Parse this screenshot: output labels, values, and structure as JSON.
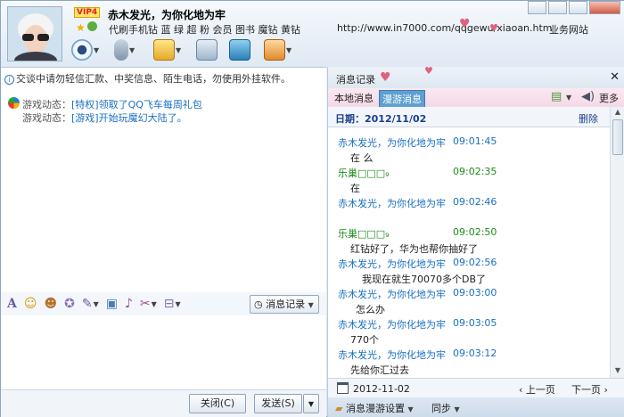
{
  "header": {
    "vip": "VIP4",
    "nickname": "赤木发光，为你化地为牢",
    "signature": "代刷手机钻 蓝 绿 超 粉 会员  图书  魔钻  黄钻",
    "url": "http://www.in7000.com/qqgewu/xiaoan.htm",
    "business": "业务网站"
  },
  "left": {
    "warning": "交谈中请勿轻信汇款、中奖信息、陌生电话，勿使用外挂软件。",
    "game": [
      {
        "label": "游戏动态：",
        "msg": "[特权]领取了QQ飞车每周礼包"
      },
      {
        "label": "游戏动态：",
        "msg": "[游戏]开始玩魔幻大陆了。"
      }
    ],
    "msg_history_btn": "消息记录",
    "close_btn": "关闭(C)",
    "send_btn": "发送(S)"
  },
  "right": {
    "title": "消息记录",
    "tab_local": "本地消息",
    "tab_roam": "漫游消息",
    "more": "更多",
    "date_label": "日期：2012/11/02",
    "delete": "删除",
    "messages": [
      {
        "sender": "赤木发光，为你化地为牢",
        "time": "09:01:45",
        "text": "在 么"
      },
      {
        "sender": "乐巢□□□₉",
        "time": "09:02:35",
        "text": "在"
      },
      {
        "sender": "赤木发光，为你化地为牢",
        "time": "09:02:46",
        "text": ""
      },
      {
        "sender": "乐巢□□□₉",
        "time": "09:02:50",
        "text": "红钻好了，华为也帮你抽好了"
      },
      {
        "sender": "赤木发光，为你化地为牢",
        "time": "09:02:56",
        "text": "我现在就生70070多个DB了"
      },
      {
        "sender": "赤木发光，为你化地为牢",
        "time": "09:03:00",
        "text": "怎么办"
      },
      {
        "sender": "赤木发光，为你化地为牢",
        "time": "09:03:05",
        "text": "770个"
      },
      {
        "sender": "赤木发光，为你化地为牢",
        "time": "09:03:12",
        "text": "先给你汇过去"
      }
    ],
    "nav_date": "2012-11-02",
    "prev": "上一页",
    "next": "下一页",
    "roam_settings": "消息漫游设置",
    "sync": "同步"
  },
  "colors": {
    "blue_sender": "#1a6fc0",
    "green_sender": "#1d8a1d",
    "title_bar": "#dde8f3"
  }
}
